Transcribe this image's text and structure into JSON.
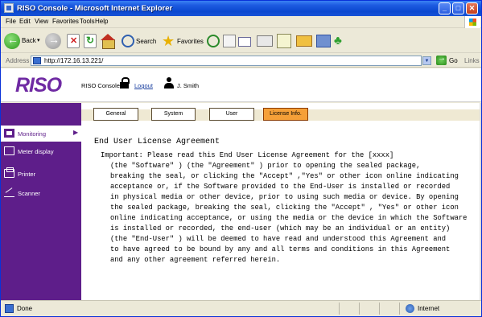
{
  "window": {
    "title": "RISO Console - Microsoft Internet Explorer"
  },
  "menu": [
    "File",
    "Edit",
    "View",
    "Favorites",
    "Tools",
    "Help"
  ],
  "toolbar": {
    "back_label": "Back",
    "search_label": "Search",
    "favorites_label": "Favorites"
  },
  "address": {
    "label": "Address",
    "url": "http://172.16.13.221/",
    "go_label": "Go",
    "links_label": "Links"
  },
  "header": {
    "logo": "RISO",
    "app_label": "RISO Console",
    "logout": "Logout",
    "user": "J. Smith"
  },
  "sidebar": {
    "items": [
      {
        "label": "Monitoring",
        "active": true,
        "icon": "monitor-icon"
      },
      {
        "label": "Meter display",
        "active": false,
        "icon": "meter-icon"
      },
      {
        "label": "Printer",
        "active": false,
        "icon": "printer-icon"
      },
      {
        "label": "Scanner",
        "active": false,
        "icon": "scanner-icon"
      }
    ]
  },
  "tabs": [
    {
      "label": "General"
    },
    {
      "label": "System"
    },
    {
      "label": "User"
    },
    {
      "label": "License Info."
    }
  ],
  "eula": {
    "title": "End User License Agreement",
    "lines": [
      "Important: Please read this End User License Agreement for the [xxxx]",
      "(the \"Software\" ) (the \"Agreement\" ) prior to opening the sealed package,",
      "breaking the seal, or clicking the \"Accept\" ,\"Yes\" or other icon online indicating",
      "acceptance or, if the Software provided to the End-User is installed or recorded",
      "in physical media or other device, prior to using such media or device. By opening",
      "the sealed package, breaking the seal, clicking the \"Accept\" , \"Yes\" or other icon",
      "online indicating acceptance, or using the media or the device in which the Software",
      "is installed or recorded, the end-user (which may be an individual or an entity)",
      "(the \"End-User\" ) will be deemed to have read and understood this Agreement and",
      "to have agreed to be bound by any and all terms and conditions in this Agreement",
      "and any other agreement referred herein."
    ]
  },
  "status": {
    "text": "Done",
    "zone": "Internet"
  },
  "colors": {
    "riso_purple": "#5e1e8a",
    "active_tab": "#f5a038",
    "xp_titlebar": "#0a48d0"
  }
}
